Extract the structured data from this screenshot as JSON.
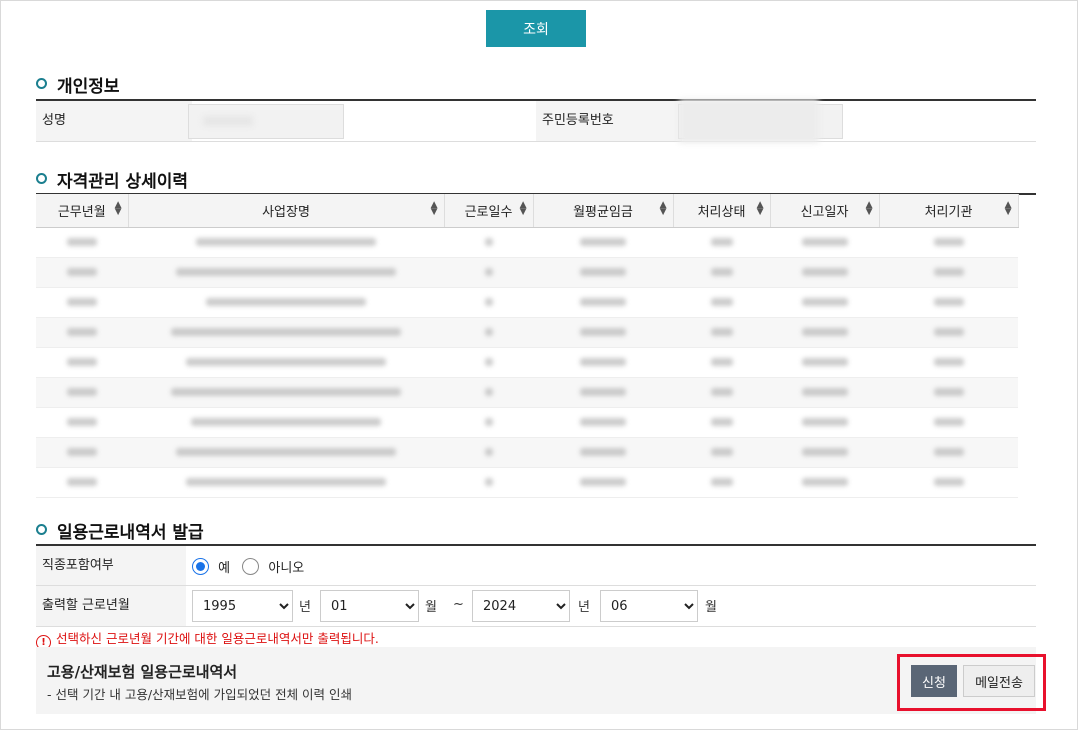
{
  "search_label": "조회",
  "personal": {
    "title": "개인정보",
    "name_label": "성명",
    "rrn_label": "주민등록번호"
  },
  "history": {
    "title": "자격관리 상세이력",
    "columns": [
      "근무년월",
      "사업장명",
      "근로일수",
      "월평균임금",
      "처리상태",
      "신고일자",
      "처리기관"
    ],
    "row_count": 9
  },
  "issue": {
    "title": "일용근로내역서 발급",
    "job_label": "직종포함여부",
    "yes_label": "예",
    "no_label": "아니오",
    "yes_selected": true,
    "period_label": "출력할 근로년월",
    "start_year": "1995",
    "start_month": "01",
    "end_year": "2024",
    "end_month": "06",
    "year_unit": "년",
    "month_unit": "월",
    "tilde": "~",
    "warning": "선택하신 근로년월 기간에 대한 일용근로내역서만 출력됩니다.",
    "doc_title": "고용/산재보험 일용근로내역서",
    "doc_desc": "- 선택 기간 내 고용/산재보험에 가입되었던 전체 이력 인쇄",
    "apply_label": "신청",
    "mail_label": "메일전송"
  },
  "colors": {
    "accent": "#1b96a8",
    "highlight": "#e8112d",
    "apply_bg": "#5a6676"
  }
}
